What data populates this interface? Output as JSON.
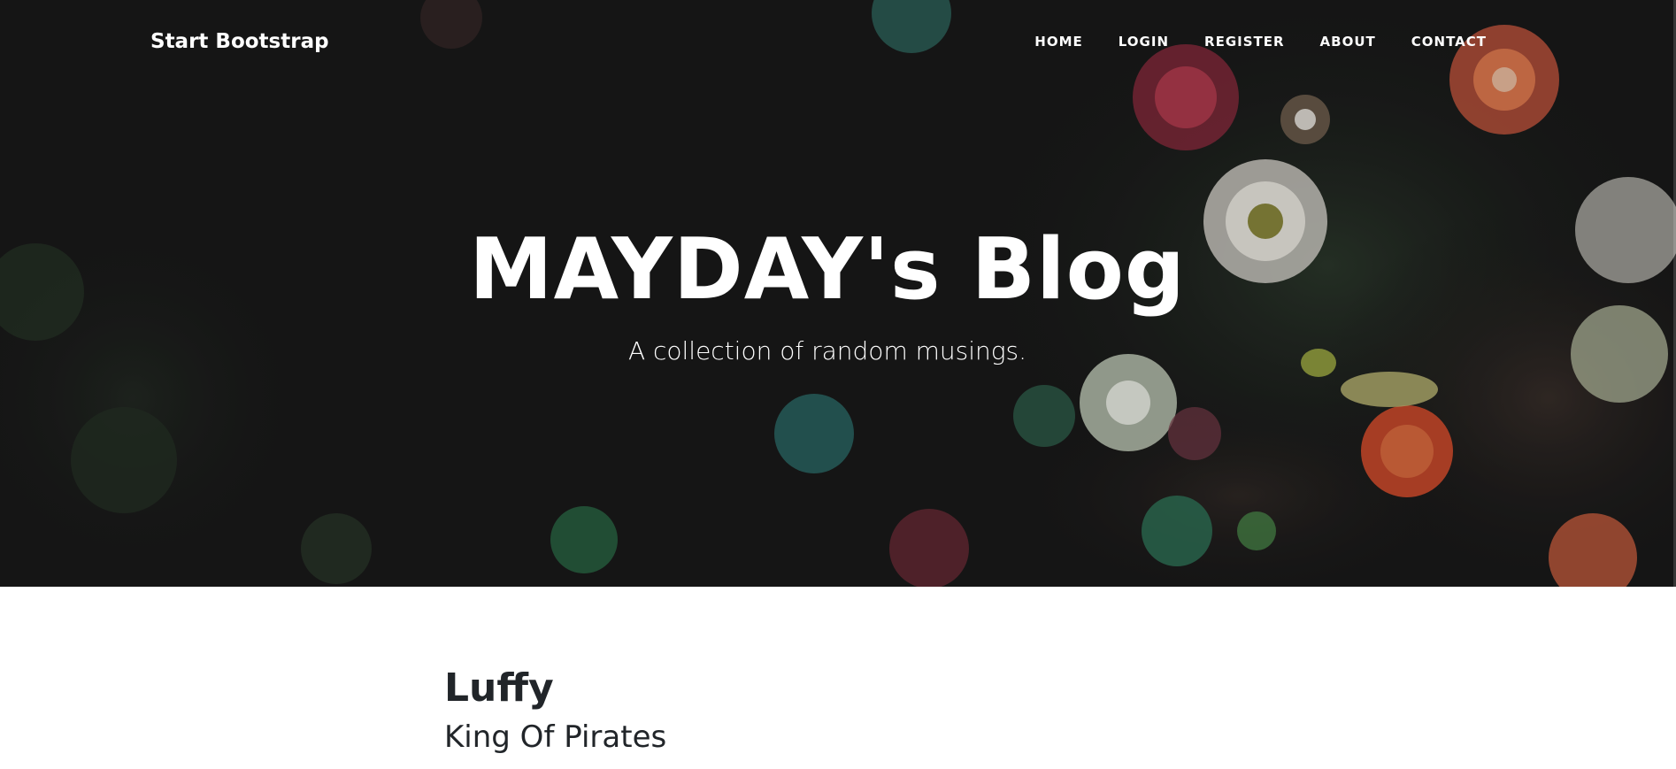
{
  "navbar": {
    "brand": "Start Bootstrap",
    "items": [
      {
        "label": "HOME"
      },
      {
        "label": "LOGIN"
      },
      {
        "label": "REGISTER"
      },
      {
        "label": "ABOUT"
      },
      {
        "label": "CONTACT"
      }
    ]
  },
  "header": {
    "title": "MAYDAY's Blog",
    "subtitle": "A collection of random musings."
  },
  "posts": [
    {
      "title": "Luffy",
      "subtitle": "King Of Pirates"
    }
  ],
  "colors": {
    "hero_background": "#161616",
    "text_light": "#ffffff",
    "text_dark": "#212529"
  }
}
